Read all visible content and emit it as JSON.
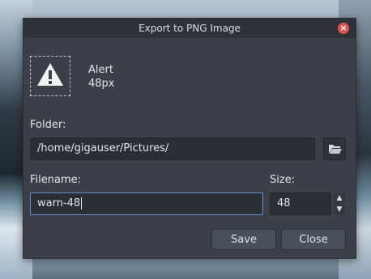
{
  "dialog": {
    "title": "Export to PNG Image"
  },
  "asset": {
    "name": "Alert",
    "size": "48px",
    "icon": "warning-icon"
  },
  "folder": {
    "label": "Folder:",
    "value": "/home/gigauser/Pictures/"
  },
  "filename": {
    "label": "Filename:",
    "value": "warn-48"
  },
  "size": {
    "label": "Size:",
    "value": "48"
  },
  "buttons": {
    "save": "Save",
    "close": "Close"
  },
  "colors": {
    "dialog_bg": "#3c3f48",
    "titlebar_bg": "#303239",
    "close_red": "#d9534f",
    "focus_blue": "#5d91cf"
  }
}
